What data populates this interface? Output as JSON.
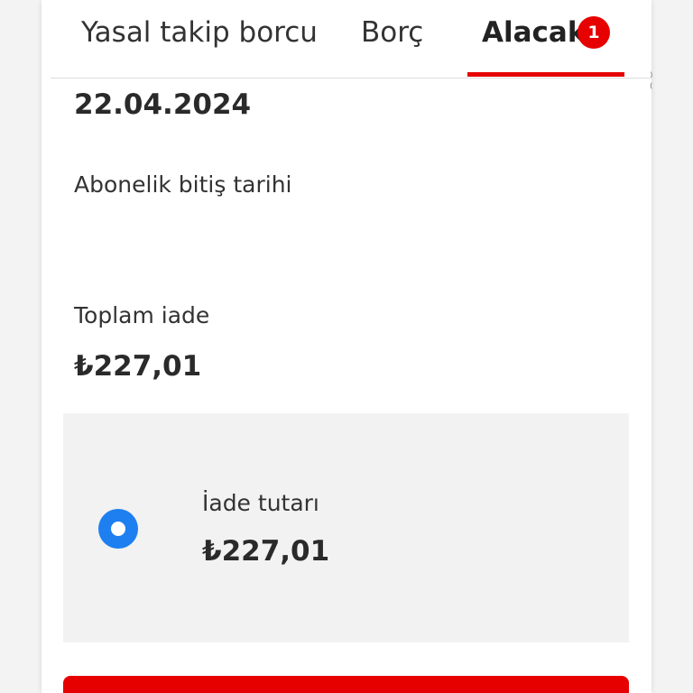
{
  "tabs": [
    {
      "label": "Yasal takip borcu"
    },
    {
      "label": "Borç"
    },
    {
      "label": "Alacak",
      "badge": "1",
      "active": true
    }
  ],
  "colors": {
    "accent": "#e60000",
    "radio": "#1e7ff0",
    "option_background": "#f2f2f2"
  },
  "details": {
    "date_value": "22.04.2024",
    "subscription_end_label": "Abonelik bitiş tarihi",
    "total_refund_label": "Toplam iade",
    "total_refund_value": "₺227,01"
  },
  "refund_option": {
    "label": "İade tutarı",
    "amount": "₺227,01",
    "selected": true,
    "icon": "radio-selected-icon"
  }
}
